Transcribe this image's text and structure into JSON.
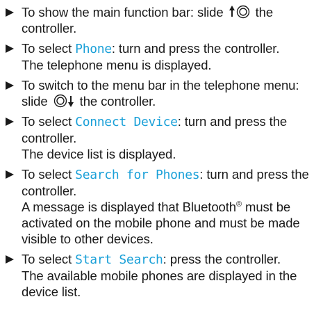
{
  "steps": [
    {
      "prefix": "To show the main function bar: slide",
      "suffix": "the controller."
    },
    {
      "prefix": "To select",
      "keyword": "Phone",
      "suffix": ": turn and press the controller.",
      "result": "The telephone menu is displayed."
    },
    {
      "prefix": "To switch to the menu bar in the telephone menu: slide",
      "suffix": "the controller."
    },
    {
      "prefix": "To select",
      "keyword": "Connect Device",
      "suffix": ": turn and press the controller.",
      "result": "The device list is displayed."
    },
    {
      "prefix": "To select",
      "keyword": "Search for Phones",
      "suffix": ": turn and press the controller.",
      "result_part1": "A message is displayed that Bluetooth",
      "result_sup": "®",
      "result_part2": "must be activated on the mobile phone and must be made visible to other devices."
    },
    {
      "prefix": "To select",
      "keyword": "Start Search",
      "suffix": ": press the controller.",
      "result": "The available mobile phones are displayed in the device list."
    }
  ],
  "icons": {
    "slide_up": "controller-slide-up-icon",
    "slide_down": "controller-slide-down-icon",
    "bullet": "triangle-bullet-icon"
  },
  "colors": {
    "text": "#1a1a1a",
    "keyword": "#1aa0d8"
  }
}
